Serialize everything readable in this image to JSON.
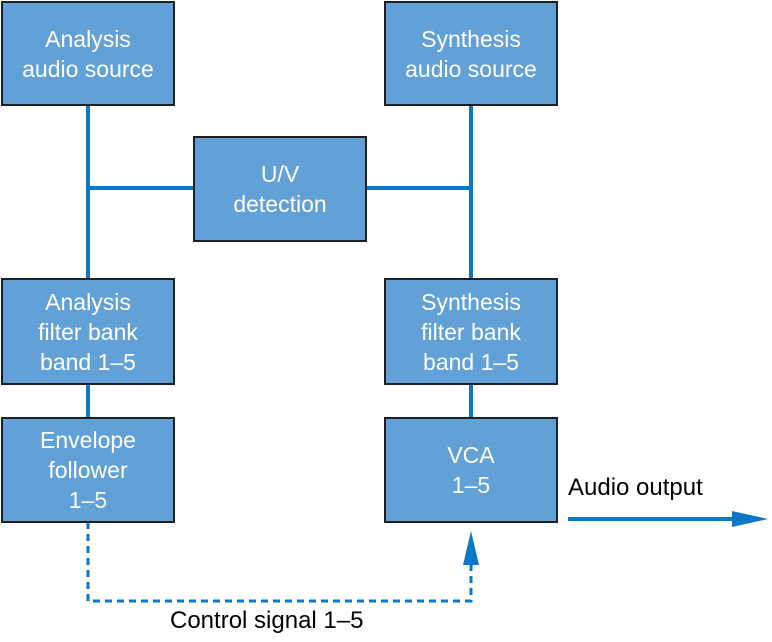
{
  "colors": {
    "box_fill": "#62a0d8",
    "box_border": "#1f1f1f",
    "line": "#0a78c8"
  },
  "boxes": {
    "analysis_source": "Analysis\naudio source",
    "synthesis_source": "Synthesis\naudio source",
    "uv_detection": "U/V\ndetection",
    "analysis_filter": "Analysis\nfilter bank\nband 1–5",
    "synthesis_filter": "Synthesis\nfilter bank\nband 1–5",
    "envelope": "Envelope\nfollower\n1–5",
    "vca": "VCA\n1–5"
  },
  "labels": {
    "audio_output": "Audio output",
    "control_signal": "Control signal 1–5"
  }
}
